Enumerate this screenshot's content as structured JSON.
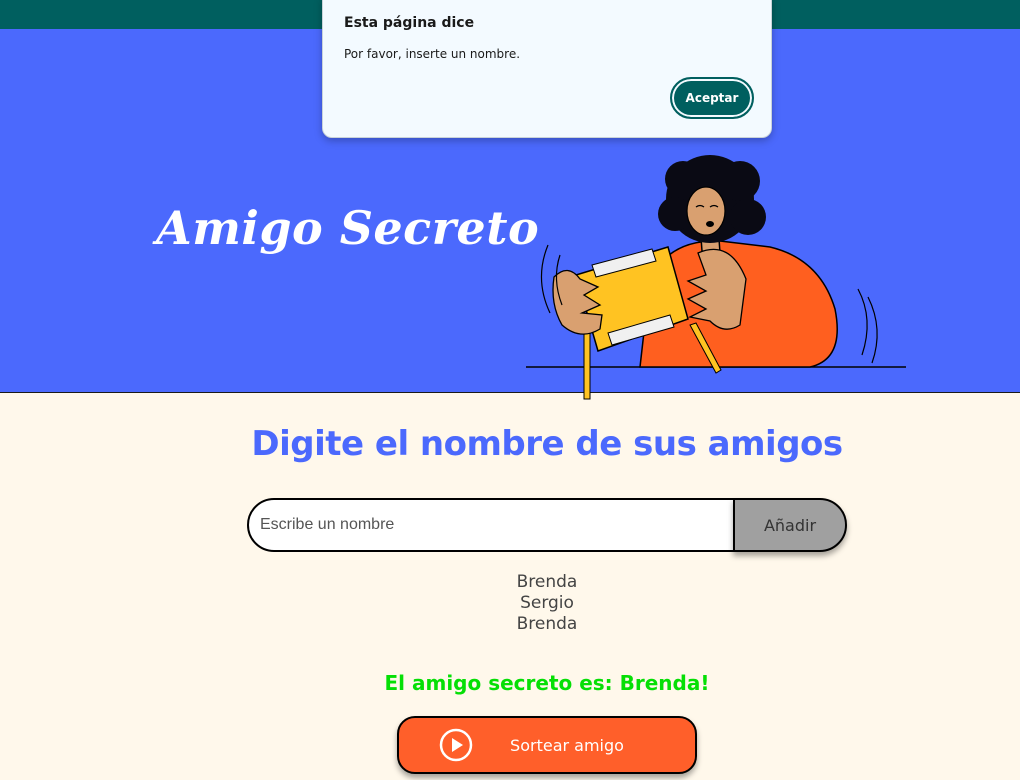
{
  "colors": {
    "top_strip": "#005F5F",
    "hero_background": "#4B69FD",
    "page_background": "#FFF8EB",
    "section_title": "#4B69FD",
    "result_text": "#05DF05",
    "draw_button": "#FF5F2A",
    "add_button": "#A0A0A0",
    "dialog_button": "#005F5F"
  },
  "hero": {
    "title": "Amigo Secreto",
    "illustration_icon": "person-opening-gift-illustration"
  },
  "main": {
    "title": "Digite el nombre de sus amigos",
    "input": {
      "placeholder": "Escribe un nombre",
      "value": ""
    },
    "add_label": "Añadir",
    "friends": [
      "Brenda",
      "Sergio",
      "Brenda"
    ],
    "result": "El amigo secreto es: Brenda!",
    "draw_label": "Sortear amigo",
    "draw_icon": "play-circle-icon"
  },
  "dialog": {
    "title": "Esta página dice",
    "message": "Por favor, inserte un nombre.",
    "accept_label": "Aceptar"
  }
}
